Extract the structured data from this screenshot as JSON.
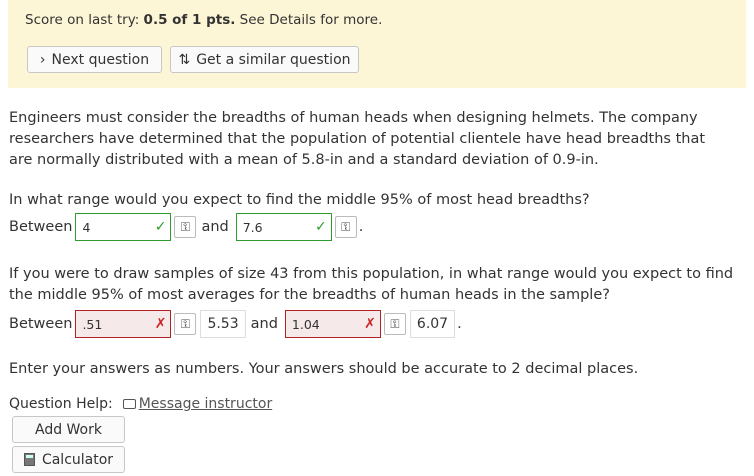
{
  "score": {
    "prefix": "Score on last try: ",
    "value": "0.5 of 1 pts.",
    "suffix": " See Details for more."
  },
  "buttons": {
    "next": "Next question",
    "similar": "Get a similar question",
    "add_work": "Add Work",
    "calculator": "Calculator"
  },
  "question": {
    "intro": "Engineers must consider the breadths of human heads when designing helmets. The company researchers have determined that the population of potential clientele have head breadths that are normally distributed with a mean of 5.8-in and a standard deviation of 0.9-in.",
    "part1_prompt": "In what range would you expect to find the middle 95% of most head breadths?",
    "part2_prompt": "If you were to draw samples of size 43 from this population, in what range would you expect to find the middle 95% of most averages for the breadths of human heads in the sample?",
    "instructions": "Enter your answers as numbers. Your answers should be accurate to 2 decimal places."
  },
  "labels": {
    "between": "Between",
    "and": "and",
    "period": "."
  },
  "answers": {
    "part1_low": "4",
    "part1_high": "7.6",
    "part2_low": ".51",
    "part2_low_correct": "5.53",
    "part2_high": "1.04",
    "part2_high_correct": "6.07"
  },
  "help": {
    "label": "Question Help:",
    "link": "Message instructor"
  },
  "colors": {
    "banner": "#fdf6d6",
    "correct": "#2e9b2e",
    "wrong": "#b22222"
  }
}
